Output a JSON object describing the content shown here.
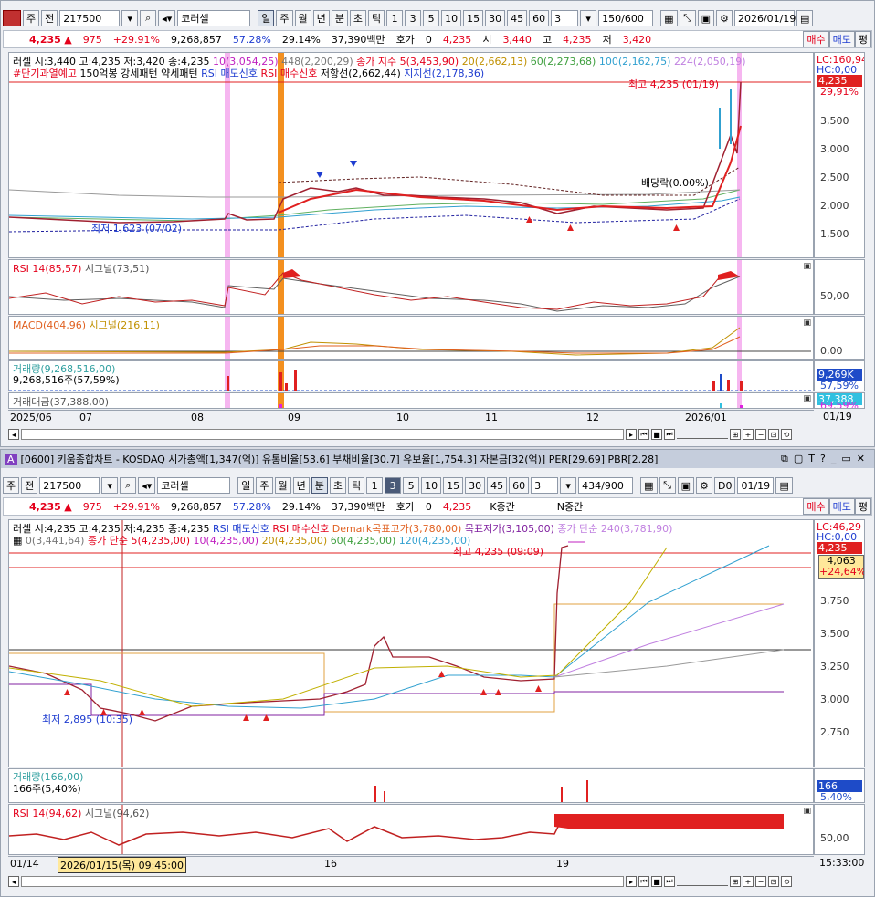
{
  "chart1": {
    "toolbar": {
      "market": "주",
      "prev": "전",
      "code": "217500",
      "name": "코러셀",
      "periods": [
        "일",
        "주",
        "월",
        "년",
        "분",
        "초",
        "틱"
      ],
      "active_period": "일",
      "nums": [
        "1",
        "3",
        "5",
        "10",
        "15",
        "30",
        "45",
        "60"
      ],
      "count": "3",
      "range": "150/600",
      "date": "2026/01/19"
    },
    "quote": {
      "price": "4,235",
      "change": "975",
      "rate": "+29.91%",
      "volume": "9,268,857",
      "r1": "57.28%",
      "r2": "29.14%",
      "amount": "37,390백만",
      "hoga_label": "호가",
      "hoga": "0",
      "price2": "4,235",
      "open_label": "시",
      "open": "3,440",
      "high_label": "고",
      "high": "4,235",
      "low_label": "저",
      "low": "3,420",
      "buy": "매수",
      "sell": "매도",
      "flat": "평"
    },
    "legend1": {
      "ohlc": "러셀 시:3,440 고:4,235 저:3,420 종:4,235",
      "ma10": "10(3,054,25)",
      "ma448": "448(2,200,29)",
      "ema5": "종가 지수 5(3,453,90)",
      "ma20": "20(2,662,13)",
      "ma60": "60(2,273,68)",
      "ma100": "100(2,162,75)",
      "ma224": "224(2,050,19)"
    },
    "legend2": {
      "a": "#단기과열예고",
      "b": "150억봉 강세패턴",
      "c": "약세패턴",
      "d": "RSI 매도신호",
      "e": "RSI 매수신호",
      "f": "저항선(2,662,44)",
      "g": "지지선(2,178,36)"
    },
    "annotations": {
      "high": "최고 4,235 (01/19)",
      "low": "최저 1,623 (07/02)",
      "dividend": "배당락(0.00%)"
    },
    "right_labels": {
      "lc": "LC:160,94",
      "hc": "HC:0,00",
      "price": "4,235",
      "pct": "29,91%"
    },
    "price_ticks": [
      "3,500",
      "3,000",
      "2,500",
      "2,000",
      "1,500"
    ],
    "rsi": {
      "label": "RSI 14(85,57)",
      "signal": "시그널(73,51)",
      "tick": "50,00"
    },
    "macd": {
      "label": "MACD(404,96)",
      "signal": "시그널(216,11)",
      "tick": "0,00"
    },
    "volume": {
      "label": "거래량(9,268,516,00)",
      "sub": "9,268,516주(57,59%)",
      "tag1": "9,269K",
      "tag2": "57,59%"
    },
    "amount": {
      "label": "거래대금(37,388,00)",
      "tag1": "37,388",
      "tag2": "69,59%"
    },
    "xaxis": [
      "2025/06",
      "07",
      "08",
      "09",
      "10",
      "11",
      "12",
      "2026/01",
      "01/19"
    ]
  },
  "chart2": {
    "title": "[0600] 키움종합차트 - KOSDAQ 시가총액[1,347(억)] 유통비율[53.6] 부채비율[30.7] 유보율[1,754.3] 자본금[32(억)] PER[29.69] PBR[2.28]",
    "title_icon": "A",
    "toolbar": {
      "market": "주",
      "prev": "전",
      "code": "217500",
      "name": "코러셀",
      "periods": [
        "일",
        "주",
        "월",
        "년",
        "분",
        "초",
        "틱"
      ],
      "active_period": "분",
      "nums": [
        "1",
        "3",
        "5",
        "10",
        "15",
        "30",
        "45",
        "60"
      ],
      "active_num": "3",
      "count": "3",
      "range": "434/900",
      "d0": "D0",
      "date": "01/19"
    },
    "quote": {
      "price": "4,235",
      "change": "975",
      "rate": "+29.91%",
      "volume": "9,268,857",
      "r1": "57.28%",
      "r2": "29.14%",
      "amount": "37,390백만",
      "hoga_label": "호가",
      "hoga": "0",
      "price2": "4,235",
      "k": "K중간",
      "n": "N중간",
      "buy": "매수",
      "sell": "매도",
      "flat": "평"
    },
    "legend1": {
      "ohlc": "러셀 시:4,235 고:4,235 저:4,235 종:4,235",
      "a": "RSI 매도신호",
      "b": "RSI 매수신호",
      "c": "Demark목표고가(3,780,00)",
      "d": "목표저가(3,105,00)",
      "e": "종가 단순 240(3,781,90)"
    },
    "legend2": {
      "a": "0(3,441,64)",
      "b": "종가 단순 5(4,235,00)",
      "c": "10(4,235,00)",
      "d": "20(4,235,00)",
      "e": "60(4,235,00)",
      "f": "120(4,235,00)"
    },
    "annotations": {
      "high": "최고 4,235 (09:09)",
      "low": "최저 2,895 (10:35)"
    },
    "right_labels": {
      "lc": "LC:46,29",
      "hc": "HC:0,00",
      "price": "4,235",
      "box1": "4,063",
      "box2": "+24,64%"
    },
    "price_ticks": [
      "3,750",
      "3,500",
      "3,250",
      "3,000",
      "2,750"
    ],
    "volume": {
      "label": "거래량(166,00)",
      "sub": "166주(5,40%)",
      "tag1": "166",
      "tag2": "5,40%"
    },
    "rsi": {
      "label": "RSI 14(94,62)",
      "signal": "시그널(94,62)",
      "tick": "50,00"
    },
    "xaxis": [
      "01/14",
      "2026/01/15(목) 09:45:00",
      "16",
      "19",
      "15:33:00"
    ]
  }
}
